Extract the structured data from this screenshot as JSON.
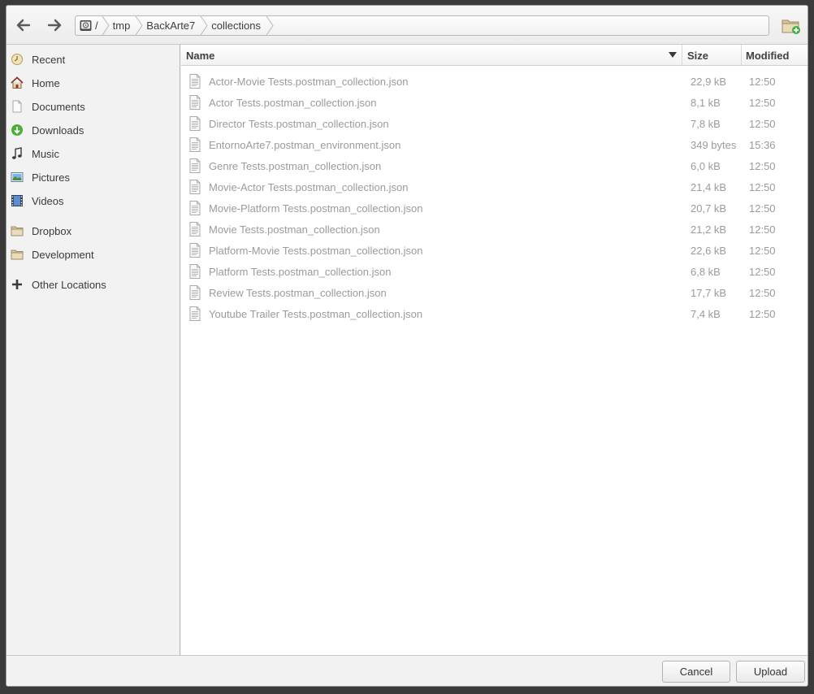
{
  "toolbar": {
    "back_icon": "arrow-left-icon",
    "forward_icon": "arrow-right-icon",
    "new_folder_icon": "new-folder-icon"
  },
  "pathbar": {
    "crumbs": [
      {
        "label": "/",
        "icon": "drive-icon"
      },
      {
        "label": "tmp"
      },
      {
        "label": "BackArte7"
      },
      {
        "label": "collections"
      }
    ]
  },
  "sidebar": {
    "items": [
      {
        "label": "Recent",
        "icon": "recent-icon"
      },
      {
        "label": "Home",
        "icon": "home-icon"
      },
      {
        "label": "Documents",
        "icon": "documents-icon"
      },
      {
        "label": "Downloads",
        "icon": "downloads-icon"
      },
      {
        "label": "Music",
        "icon": "music-icon"
      },
      {
        "label": "Pictures",
        "icon": "pictures-icon"
      },
      {
        "label": "Videos",
        "icon": "videos-icon"
      },
      {
        "label": "Dropbox",
        "icon": "folder-icon"
      },
      {
        "label": "Development",
        "icon": "folder-icon"
      },
      {
        "label": "Other Locations",
        "icon": "plus-icon"
      }
    ]
  },
  "columns": {
    "name": "Name",
    "size": "Size",
    "modified": "Modified"
  },
  "files": [
    {
      "name": "Actor-Movie Tests.postman_collection.json",
      "size": "22,9 kB",
      "modified": "12:50"
    },
    {
      "name": "Actor Tests.postman_collection.json",
      "size": "8,1 kB",
      "modified": "12:50"
    },
    {
      "name": "Director Tests.postman_collection.json",
      "size": "7,8 kB",
      "modified": "12:50"
    },
    {
      "name": "EntornoArte7.postman_environment.json",
      "size": "349 bytes",
      "modified": "15:36"
    },
    {
      "name": "Genre Tests.postman_collection.json",
      "size": "6,0 kB",
      "modified": "12:50"
    },
    {
      "name": "Movie-Actor Tests.postman_collection.json",
      "size": "21,4 kB",
      "modified": "12:50"
    },
    {
      "name": "Movie-Platform Tests.postman_collection.json",
      "size": "20,7 kB",
      "modified": "12:50"
    },
    {
      "name": "Movie Tests.postman_collection.json",
      "size": "21,2 kB",
      "modified": "12:50"
    },
    {
      "name": "Platform-Movie Tests.postman_collection.json",
      "size": "22,6 kB",
      "modified": "12:50"
    },
    {
      "name": "Platform Tests.postman_collection.json",
      "size": "6,8 kB",
      "modified": "12:50"
    },
    {
      "name": "Review Tests.postman_collection.json",
      "size": "17,7 kB",
      "modified": "12:50"
    },
    {
      "name": "Youtube Trailer Tests.postman_collection.json",
      "size": "7,4 kB",
      "modified": "12:50"
    }
  ],
  "buttons": {
    "cancel": "Cancel",
    "upload": "Upload"
  },
  "colors": {
    "window_bg": "#f5f5f5",
    "content_bg": "#ffffff",
    "dimmed_text": "#9b9b9b",
    "downloads_green": "#4caf3a",
    "new_folder_plus": "#3cb043"
  }
}
